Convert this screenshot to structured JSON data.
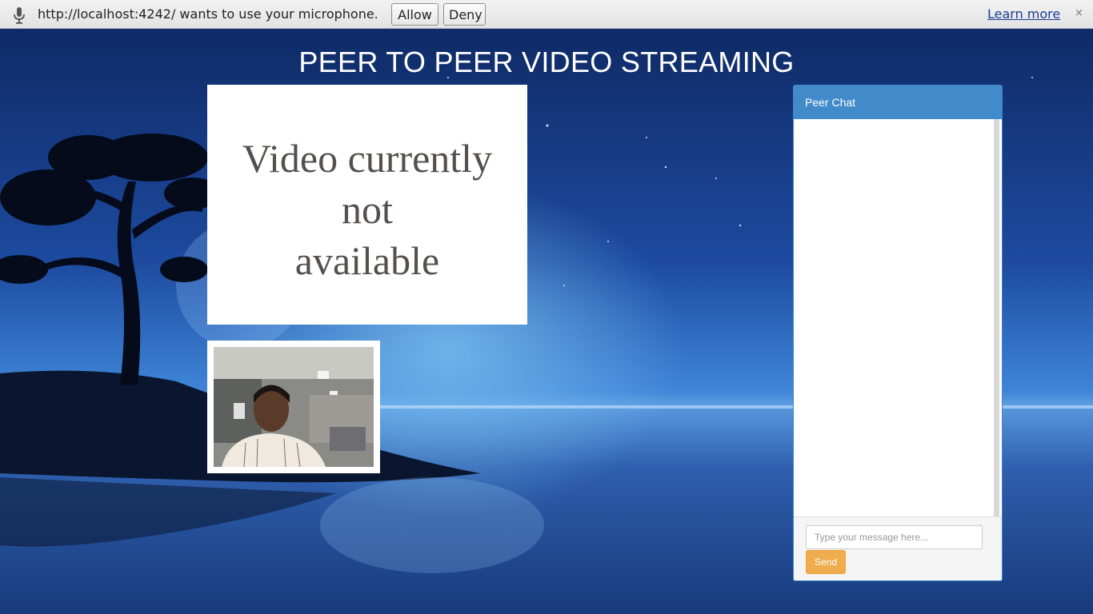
{
  "infobar": {
    "icon": "microphone-icon",
    "message": "http://localhost:4242/ wants to use your microphone.",
    "allow_label": "Allow",
    "deny_label": "Deny",
    "learn_more_label": "Learn more",
    "close_glyph": "×"
  },
  "page": {
    "title": "PEER TO PEER VIDEO STREAMING"
  },
  "remote_video": {
    "placeholder_lines": [
      "Video currently",
      "not",
      "available"
    ]
  },
  "chat": {
    "title": "Peer Chat",
    "input_placeholder": "Type your message here...",
    "send_label": "Send",
    "colors": {
      "header": "#428bca",
      "send": "#f0ad4e"
    }
  }
}
